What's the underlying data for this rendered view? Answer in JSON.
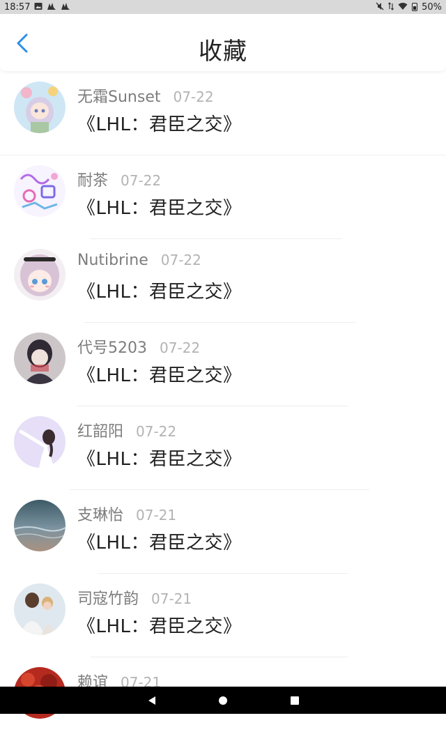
{
  "status_bar": {
    "time": "18:57",
    "battery": "50%",
    "icons": [
      "image-icon",
      "notification-icon",
      "notification-icon",
      "mute-icon",
      "data-arrows-icon",
      "wifi-icon",
      "battery-icon"
    ]
  },
  "header": {
    "title": "收藏",
    "back_icon": "chevron-left-icon",
    "accent_color": "#2b8fe6"
  },
  "items": [
    {
      "user": "无霜Sunset",
      "date": "07-22",
      "title": "《LHL：君臣之交》"
    },
    {
      "user": "耐茶",
      "date": "07-22",
      "title": "《LHL：君臣之交》"
    },
    {
      "user": "Nutibrine",
      "date": "07-22",
      "title": "《LHL：君臣之交》"
    },
    {
      "user": "代号5203",
      "date": "07-22",
      "title": "《LHL：君臣之交》"
    },
    {
      "user": "红韶阳",
      "date": "07-22",
      "title": "《LHL：君臣之交》"
    },
    {
      "user": "支琳怡",
      "date": "07-21",
      "title": "《LHL：君臣之交》"
    },
    {
      "user": "司寇竹韵",
      "date": "07-21",
      "title": "《LHL：君臣之交》"
    },
    {
      "user": "赖谊",
      "date": "07-21",
      "title": ""
    }
  ],
  "nav": {
    "back_icon": "triangle-back-icon",
    "home_icon": "circle-home-icon",
    "recents_icon": "square-recents-icon"
  }
}
